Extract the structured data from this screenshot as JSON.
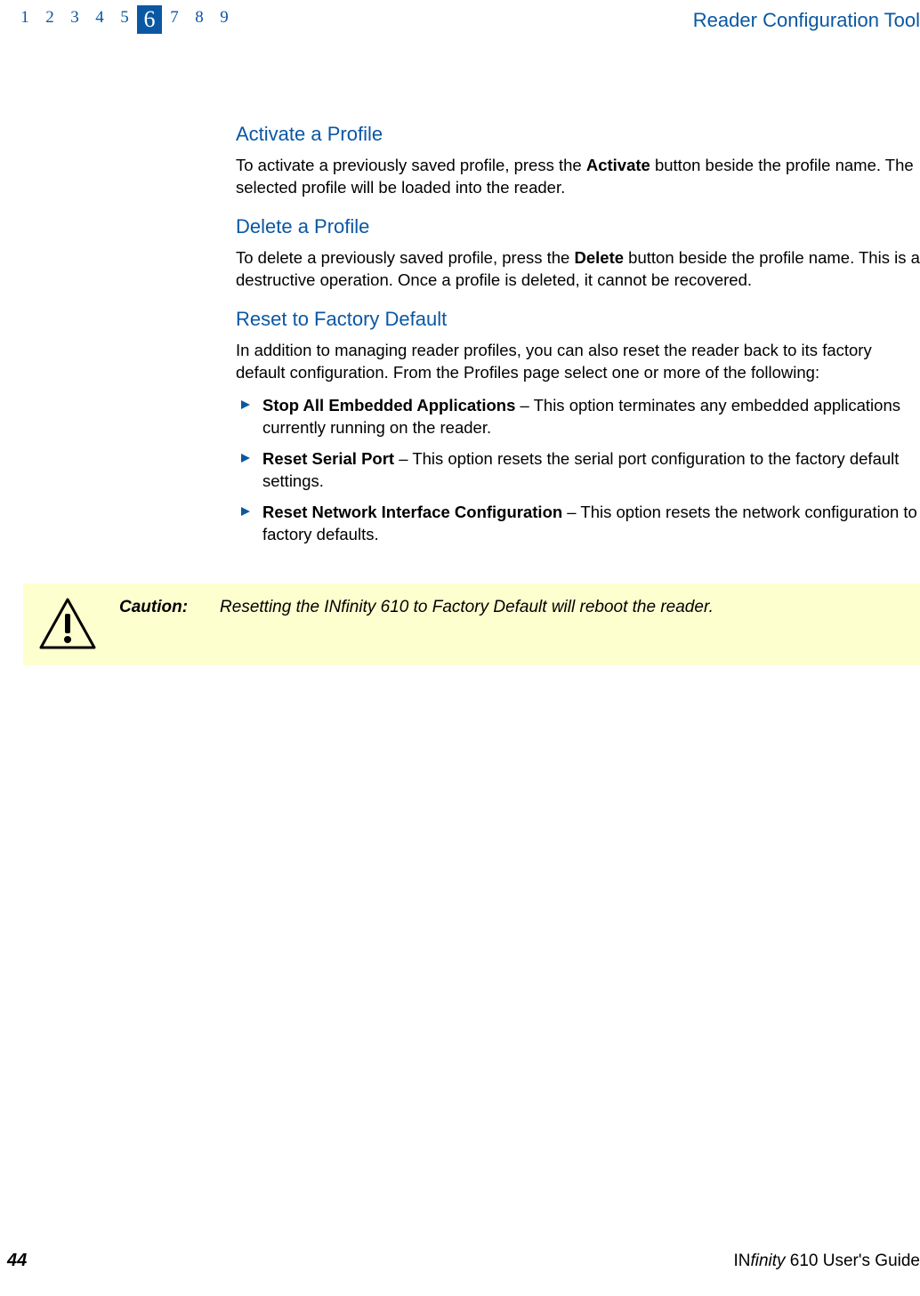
{
  "header": {
    "chapters": [
      "1",
      "2",
      "3",
      "4",
      "5",
      "6",
      "7",
      "8",
      "9"
    ],
    "current_chapter": "6",
    "title": "Reader Configuration Tool"
  },
  "sections": {
    "activate": {
      "heading": "Activate a Profile",
      "text_before_bold": "To activate a previously saved profile, press the ",
      "bold": "Activate",
      "text_after_bold": " button beside the profile name. The selected profile will be loaded into the reader."
    },
    "delete": {
      "heading": "Delete a Profile",
      "text_before_bold": "To delete a previously saved profile, press the ",
      "bold": "Delete",
      "text_after_bold": " button beside the profile name. This is a destructive operation. Once a profile is deleted, it cannot be recovered."
    },
    "reset": {
      "heading": "Reset to Factory Default",
      "intro": "In addition to managing reader profiles, you can also reset the reader back to its factory default configuration. From the Profiles page select one or more of the following:",
      "bullets": [
        {
          "bold": "Stop All Embedded Applications",
          "rest": " – This option terminates any embedded applications currently running on the reader."
        },
        {
          "bold": "Reset Serial Port",
          "rest": " – This option resets the serial port configuration to the factory default settings."
        },
        {
          "bold": "Reset Network Interface Configuration",
          "rest": " – This option resets the network configuration to factory defaults."
        }
      ]
    }
  },
  "caution": {
    "label": "Caution:",
    "text": "Resetting the INfinity 610 to Factory Default will reboot the reader."
  },
  "footer": {
    "page": "44",
    "product_prefix": "IN",
    "product_italic": "finity",
    "product_suffix": " 610 User's Guide"
  }
}
